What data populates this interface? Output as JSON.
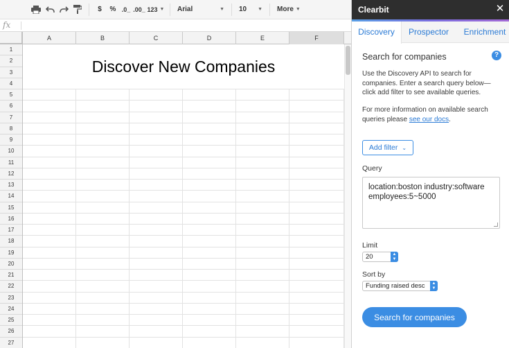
{
  "toolbar": {
    "percent_label": "%",
    "currency_label": "$",
    "dec_decrease_label": ".0_",
    "dec_increase_label": ".00_",
    "number_format_label": "123",
    "font_label": "Arial",
    "font_size_label": "10",
    "more_label": "More"
  },
  "formula_bar": {
    "fx_label": "fx"
  },
  "sheet": {
    "columns": [
      "A",
      "B",
      "C",
      "D",
      "E",
      "F"
    ],
    "selected_column": "F",
    "rows": [
      "1",
      "2",
      "3",
      "4",
      "5",
      "6",
      "7",
      "8",
      "9",
      "10",
      "11",
      "12",
      "13",
      "14",
      "15",
      "16",
      "17",
      "18",
      "19",
      "20",
      "21",
      "22",
      "23",
      "24",
      "25",
      "26",
      "27"
    ],
    "title": "Discover New Companies"
  },
  "sidebar": {
    "title": "Clearbit",
    "close_label": "✕",
    "tabs": [
      {
        "label": "Discovery"
      },
      {
        "label": "Prospector"
      },
      {
        "label": "Enrichment"
      }
    ],
    "active_tab": "Discovery",
    "heading": "Search for companies",
    "help_label": "?",
    "para1": "Use the Discovery API to search for companies. Enter a search query below—click add filter to see available queries.",
    "para2_prefix": "For more information on available search queries please ",
    "para2_link": "see our docs",
    "para2_suffix": ".",
    "add_filter_label": "Add filter",
    "query_label": "Query",
    "query_value": "location:boston industry:software employees:5~5000",
    "limit_label": "Limit",
    "limit_value": "20",
    "sort_label": "Sort by",
    "sort_value": "Funding raised desc",
    "search_button_label": "Search for companies",
    "colors": {
      "accent": "#3b8de3",
      "header_bg": "#2e2e2e",
      "link": "#2a7ad5"
    }
  }
}
